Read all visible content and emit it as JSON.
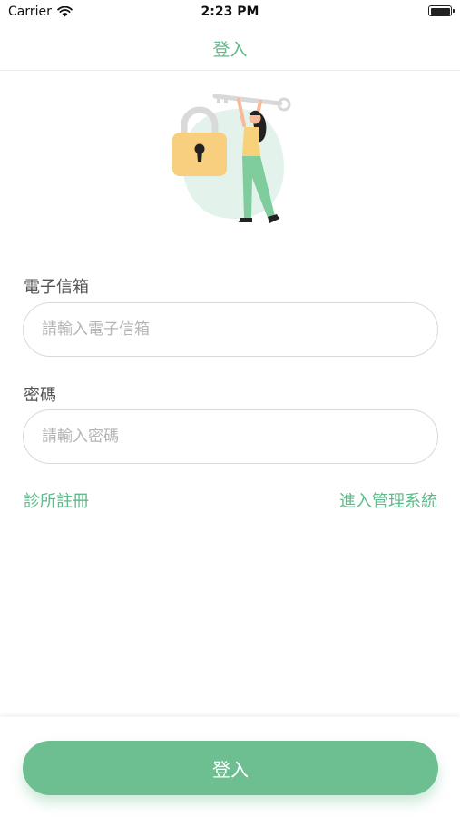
{
  "status_bar": {
    "carrier": "Carrier",
    "time": "2:23 PM",
    "wifi_icon": "wifi-icon",
    "battery_icon": "battery-icon"
  },
  "nav": {
    "title": "登入"
  },
  "illustration": {
    "icon": "padlock-with-person-holding-key",
    "colors": {
      "lock_body": "#f8cf7e",
      "blob": "#e3f3ec",
      "pants": "#7fcc9d"
    }
  },
  "form": {
    "email": {
      "label": "電子信箱",
      "placeholder": "請輸入電子信箱",
      "value": ""
    },
    "password": {
      "label": "密碼",
      "placeholder": "請輸入密碼",
      "value": ""
    }
  },
  "links": {
    "clinic_register": "診所註冊",
    "admin_system": "進入管理系統"
  },
  "footer": {
    "login_button": "登入"
  },
  "colors": {
    "accent": "#5fba89",
    "button": "#6dbf92",
    "border": "#d9d9d9"
  }
}
